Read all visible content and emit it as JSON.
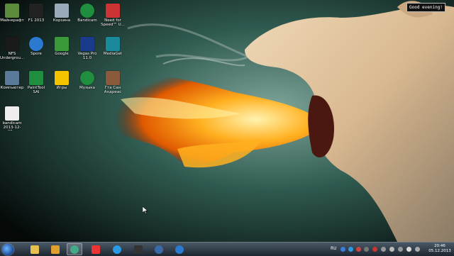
{
  "desktop": {
    "icons": [
      {
        "label": "Майнкрафт",
        "icon": "minecraft-icon"
      },
      {
        "label": "F1 2013",
        "icon": "f1-icon"
      },
      {
        "label": "Корзина",
        "icon": "recycle-bin-icon"
      },
      {
        "label": "Bandicam",
        "icon": "bandicam-icon"
      },
      {
        "label": "Need for Speed™ U...",
        "icon": "nfs-icon"
      },
      {
        "label": "NFS Undergrou...",
        "icon": "nfs-underground-icon"
      },
      {
        "label": "Spore",
        "icon": "spore-icon"
      },
      {
        "label": "Google",
        "icon": "google-icon"
      },
      {
        "label": "Vegas Pro 11.0",
        "icon": "vegas-icon"
      },
      {
        "label": "MediaGet",
        "icon": "mediaget-icon"
      },
      {
        "label": "Компьютер",
        "icon": "computer-icon"
      },
      {
        "label": "PaintTool SAI",
        "icon": "painttool-icon"
      },
      {
        "label": "Игры",
        "icon": "games-icon"
      },
      {
        "label": "Музыка",
        "icon": "music-icon"
      },
      {
        "label": "Гта Сан Андреас",
        "icon": "gta-icon"
      },
      {
        "label": "bandicam 2013-12-05...",
        "icon": "document-icon"
      }
    ],
    "tooltip": "Good evening!"
  },
  "taskbar": {
    "items": [
      "explorer-icon",
      "media-player-icon",
      "chrome-icon",
      "yandex-icon",
      "skype-icon",
      "terminal-icon",
      "steam-icon",
      "ie-icon"
    ],
    "language": "RU",
    "clock_time": "20:46",
    "clock_date": "05.12.2013"
  },
  "colors": {
    "taskbar": "#2b3642",
    "accent": "#1a4c9a"
  }
}
